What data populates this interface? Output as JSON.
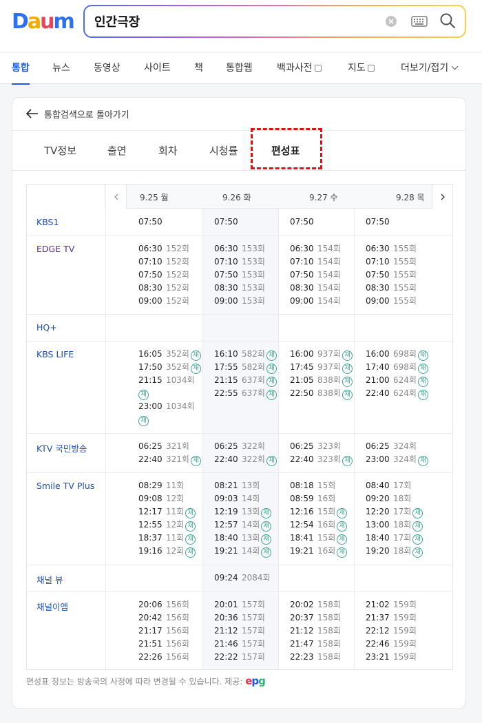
{
  "search": {
    "query": "인간극장"
  },
  "tabs": [
    {
      "label": "통합"
    },
    {
      "label": "뉴스"
    },
    {
      "label": "동영상"
    },
    {
      "label": "사이트"
    },
    {
      "label": "책"
    },
    {
      "label": "통합웹"
    },
    {
      "label": "백과사전"
    },
    {
      "label": "지도"
    },
    {
      "label": "더보기/접기"
    }
  ],
  "card": {
    "back_label": "통합검색으로 돌아가기",
    "subtabs": [
      {
        "label": "TV정보"
      },
      {
        "label": "출연"
      },
      {
        "label": "회차"
      },
      {
        "label": "시청률"
      },
      {
        "label": "편성표"
      }
    ],
    "dates": [
      "9.25 월",
      "9.26 화",
      "9.27 수",
      "9.28 목"
    ],
    "channels": [
      {
        "name": "KBS1",
        "days": [
          [
            {
              "t": "07:50",
              "e": "",
              "re": false
            }
          ],
          [
            {
              "t": "07:50",
              "e": "",
              "re": false
            }
          ],
          [
            {
              "t": "07:50",
              "e": "",
              "re": false
            }
          ],
          [
            {
              "t": "07:50",
              "e": "",
              "re": false
            }
          ]
        ]
      },
      {
        "name": "EDGE TV",
        "days": [
          [
            {
              "t": "06:30",
              "e": "152회",
              "re": false
            },
            {
              "t": "07:10",
              "e": "152회",
              "re": false
            },
            {
              "t": "07:50",
              "e": "152회",
              "re": false
            },
            {
              "t": "08:30",
              "e": "152회",
              "re": false
            },
            {
              "t": "09:00",
              "e": "152회",
              "re": false
            }
          ],
          [
            {
              "t": "06:30",
              "e": "153회",
              "re": false
            },
            {
              "t": "07:10",
              "e": "153회",
              "re": false
            },
            {
              "t": "07:50",
              "e": "153회",
              "re": false
            },
            {
              "t": "08:30",
              "e": "153회",
              "re": false
            },
            {
              "t": "09:00",
              "e": "153회",
              "re": false
            }
          ],
          [
            {
              "t": "06:30",
              "e": "154회",
              "re": false
            },
            {
              "t": "07:10",
              "e": "154회",
              "re": false
            },
            {
              "t": "07:50",
              "e": "154회",
              "re": false
            },
            {
              "t": "08:30",
              "e": "154회",
              "re": false
            },
            {
              "t": "09:00",
              "e": "154회",
              "re": false
            }
          ],
          [
            {
              "t": "06:30",
              "e": "155회",
              "re": false
            },
            {
              "t": "07:10",
              "e": "155회",
              "re": false
            },
            {
              "t": "07:50",
              "e": "155회",
              "re": false
            },
            {
              "t": "08:30",
              "e": "155회",
              "re": false
            },
            {
              "t": "09:00",
              "e": "155회",
              "re": false
            }
          ]
        ]
      },
      {
        "name": "HQ+",
        "days": [
          [],
          [],
          [],
          []
        ]
      },
      {
        "name": "KBS LIFE",
        "days": [
          [
            {
              "t": "16:05",
              "e": "352회",
              "re": true
            },
            {
              "t": "17:50",
              "e": "352회",
              "re": true
            },
            {
              "t": "21:15",
              "e": "1034회",
              "re": true
            },
            {
              "t": "23:00",
              "e": "1034회",
              "re": true
            }
          ],
          [
            {
              "t": "16:10",
              "e": "582회",
              "re": true
            },
            {
              "t": "17:55",
              "e": "582회",
              "re": true
            },
            {
              "t": "21:15",
              "e": "637회",
              "re": true
            },
            {
              "t": "22:55",
              "e": "637회",
              "re": true
            }
          ],
          [
            {
              "t": "16:00",
              "e": "937회",
              "re": true
            },
            {
              "t": "17:45",
              "e": "937회",
              "re": true
            },
            {
              "t": "21:05",
              "e": "838회",
              "re": true
            },
            {
              "t": "22:50",
              "e": "838회",
              "re": true
            }
          ],
          [
            {
              "t": "16:00",
              "e": "698회",
              "re": true
            },
            {
              "t": "17:40",
              "e": "698회",
              "re": true
            },
            {
              "t": "21:00",
              "e": "624회",
              "re": true
            },
            {
              "t": "22:40",
              "e": "624회",
              "re": true
            }
          ]
        ]
      },
      {
        "name": "KTV 국민방송",
        "days": [
          [
            {
              "t": "06:25",
              "e": "321회",
              "re": false
            },
            {
              "t": "22:40",
              "e": "321회",
              "re": true
            }
          ],
          [
            {
              "t": "06:25",
              "e": "322회",
              "re": false
            },
            {
              "t": "22:40",
              "e": "322회",
              "re": true
            }
          ],
          [
            {
              "t": "06:25",
              "e": "323회",
              "re": false
            },
            {
              "t": "22:40",
              "e": "323회",
              "re": true
            }
          ],
          [
            {
              "t": "06:25",
              "e": "324회",
              "re": false
            },
            {
              "t": "23:00",
              "e": "324회",
              "re": true
            }
          ]
        ]
      },
      {
        "name": "Smile TV Plus",
        "days": [
          [
            {
              "t": "08:29",
              "e": "11회",
              "re": false
            },
            {
              "t": "09:08",
              "e": "12회",
              "re": false
            },
            {
              "t": "12:17",
              "e": "11회",
              "re": true
            },
            {
              "t": "12:55",
              "e": "12회",
              "re": true
            },
            {
              "t": "18:37",
              "e": "11회",
              "re": true
            },
            {
              "t": "19:16",
              "e": "12회",
              "re": true
            }
          ],
          [
            {
              "t": "08:21",
              "e": "13회",
              "re": false
            },
            {
              "t": "09:03",
              "e": "14회",
              "re": false
            },
            {
              "t": "12:19",
              "e": "13회",
              "re": true
            },
            {
              "t": "12:57",
              "e": "14회",
              "re": true
            },
            {
              "t": "18:40",
              "e": "13회",
              "re": true
            },
            {
              "t": "19:21",
              "e": "14회",
              "re": true
            }
          ],
          [
            {
              "t": "08:18",
              "e": "15회",
              "re": false
            },
            {
              "t": "08:59",
              "e": "16회",
              "re": false
            },
            {
              "t": "12:16",
              "e": "15회",
              "re": true
            },
            {
              "t": "12:54",
              "e": "16회",
              "re": true
            },
            {
              "t": "18:41",
              "e": "15회",
              "re": true
            },
            {
              "t": "19:21",
              "e": "16회",
              "re": true
            }
          ],
          [
            {
              "t": "08:40",
              "e": "17회",
              "re": false
            },
            {
              "t": "09:20",
              "e": "18회",
              "re": false
            },
            {
              "t": "12:20",
              "e": "17회",
              "re": true
            },
            {
              "t": "13:00",
              "e": "18회",
              "re": true
            },
            {
              "t": "18:40",
              "e": "17회",
              "re": true
            },
            {
              "t": "19:20",
              "e": "18회",
              "re": true
            }
          ]
        ]
      },
      {
        "name": "채널 뷰",
        "days": [
          [],
          [
            {
              "t": "09:24",
              "e": "2084회",
              "re": false
            }
          ],
          [],
          []
        ]
      },
      {
        "name": "채널이엠",
        "days": [
          [
            {
              "t": "20:06",
              "e": "156회",
              "re": false
            },
            {
              "t": "20:42",
              "e": "156회",
              "re": false
            },
            {
              "t": "21:17",
              "e": "156회",
              "re": false
            },
            {
              "t": "21:51",
              "e": "156회",
              "re": false
            },
            {
              "t": "22:26",
              "e": "156회",
              "re": false
            }
          ],
          [
            {
              "t": "20:01",
              "e": "157회",
              "re": false
            },
            {
              "t": "20:36",
              "e": "157회",
              "re": false
            },
            {
              "t": "21:12",
              "e": "157회",
              "re": false
            },
            {
              "t": "21:46",
              "e": "157회",
              "re": false
            },
            {
              "t": "22:22",
              "e": "157회",
              "re": false
            }
          ],
          [
            {
              "t": "20:02",
              "e": "158회",
              "re": false
            },
            {
              "t": "20:37",
              "e": "158회",
              "re": false
            },
            {
              "t": "21:12",
              "e": "158회",
              "re": false
            },
            {
              "t": "21:47",
              "e": "158회",
              "re": false
            },
            {
              "t": "22:23",
              "e": "158회",
              "re": false
            }
          ],
          [
            {
              "t": "21:02",
              "e": "159회",
              "re": false
            },
            {
              "t": "21:37",
              "e": "159회",
              "re": false
            },
            {
              "t": "22:12",
              "e": "159회",
              "re": false
            },
            {
              "t": "22:46",
              "e": "159회",
              "re": false
            },
            {
              "t": "23:21",
              "e": "159회",
              "re": false
            }
          ]
        ]
      }
    ],
    "rerun_badge": "재",
    "footnote": "편성표 정보는 방송국의 사정에 따라 변경될 수 있습니다. 제공:",
    "provider": "epg"
  },
  "colors": {
    "accent": "#1a5be0",
    "channel_link": "#1e4eb4",
    "rerun_badge": "#3aa58f",
    "highlight": "#e01010"
  }
}
